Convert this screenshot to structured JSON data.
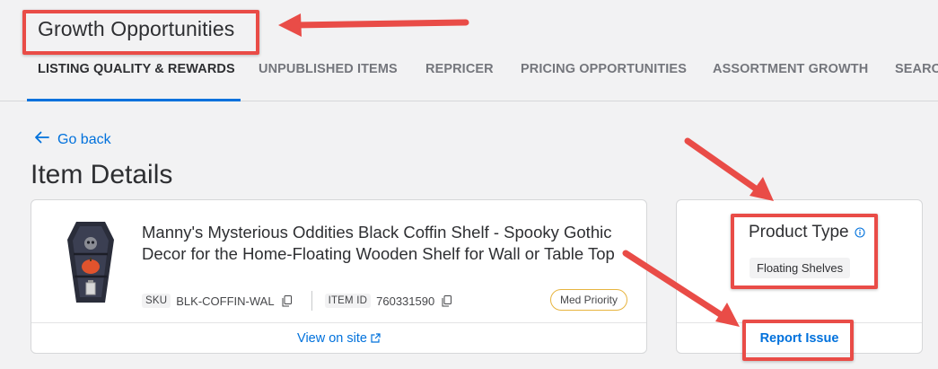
{
  "header": {
    "title": "Growth Opportunities"
  },
  "tabs": [
    {
      "label": "LISTING QUALITY & REWARDS",
      "active": true
    },
    {
      "label": "UNPUBLISHED ITEMS"
    },
    {
      "label": "REPRICER"
    },
    {
      "label": "PRICING OPPORTUNITIES"
    },
    {
      "label": "ASSORTMENT GROWTH"
    },
    {
      "label": "SEARC"
    }
  ],
  "nav": {
    "go_back": "Go back"
  },
  "page": {
    "title": "Item Details"
  },
  "item": {
    "title": "Manny's Mysterious Oddities Black Coffin Shelf - Spooky Gothic Decor for the Home-Floating Wooden Shelf for Wall or Table Top",
    "sku_label": "SKU",
    "sku": "BLK-COFFIN-WAL",
    "item_id_label": "ITEM ID",
    "item_id": "760331590",
    "priority": "Med Priority",
    "view_on_site": "View on site"
  },
  "product_type": {
    "label": "Product Type",
    "value": "Floating Shelves",
    "report_issue": "Report Issue"
  },
  "colors": {
    "accent": "#0071dc",
    "annotation": "#e94c47",
    "priority_border": "#e7b43f"
  },
  "icons": [
    "arrow-left-icon",
    "copy-icon",
    "external-link-icon",
    "info-icon"
  ]
}
